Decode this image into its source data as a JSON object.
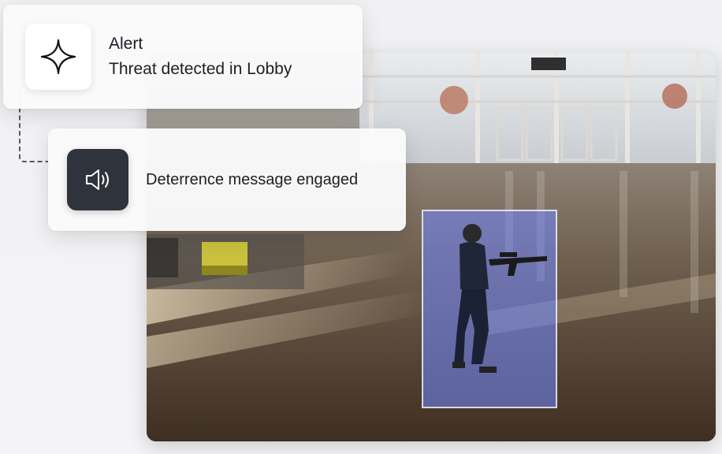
{
  "alert": {
    "title": "Alert",
    "message": "Threat detected in Lobby",
    "icon": "sparkle-icon"
  },
  "deterrence": {
    "message": "Deterrence message engaged",
    "icon": "speaker-icon"
  },
  "camera": {
    "location": "Lobby",
    "detection_box_color": "#6f86ff"
  },
  "colors": {
    "icon_dark_bg": "#2f333c",
    "card_bg": "#fafafb",
    "detection_box": "#6f86ff"
  }
}
